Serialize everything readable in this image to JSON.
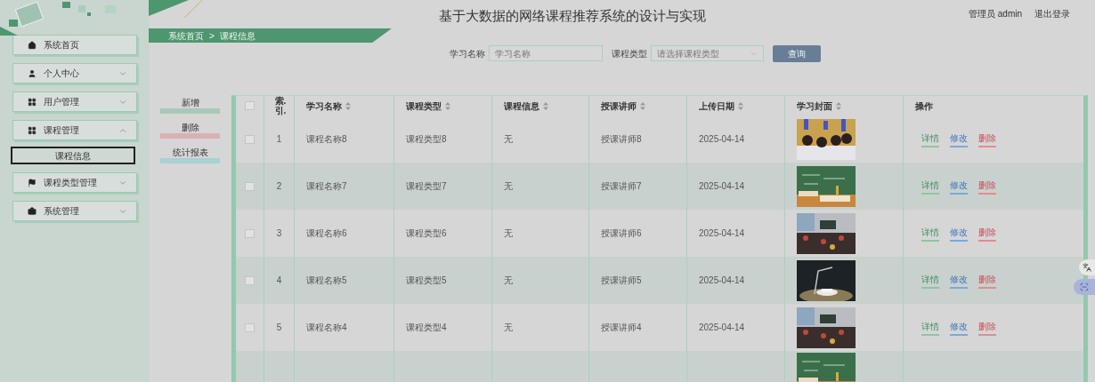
{
  "header": {
    "title": "基于大数据的网络课程推荐系统的设计与实现",
    "user": "管理员 admin",
    "logout": "退出登录"
  },
  "sidebar": {
    "items": [
      {
        "label": "系统首页"
      },
      {
        "label": "个人中心",
        "expanded": false
      },
      {
        "label": "用户管理",
        "expanded": false
      },
      {
        "label": "课程管理",
        "expanded": true,
        "children": [
          {
            "label": "课程信息",
            "selected": true
          }
        ]
      },
      {
        "label": "课程类型管理",
        "expanded": false
      },
      {
        "label": "系统管理",
        "expanded": false
      }
    ]
  },
  "breadcrumb": [
    "系统首页",
    ">",
    "课程信息"
  ],
  "search": {
    "fields": [
      {
        "label": "学习名称",
        "placeholder": "学习名称",
        "kind": "text"
      },
      {
        "label": "课程类型",
        "placeholder": "请选择课程类型",
        "kind": "select"
      }
    ],
    "button": "查询"
  },
  "actions": [
    {
      "label": "新增",
      "color": "#a9c8b8"
    },
    {
      "label": "删除",
      "color": "#dcb0b3"
    },
    {
      "label": "统计报表",
      "color": "#a9d0d2"
    }
  ],
  "table": {
    "select_all": {
      "checked": false
    },
    "columns": [
      "索.引.",
      "学习名称",
      "课程类型",
      "课程信息",
      "授课讲师",
      "上传日期",
      "学习封面",
      "操作"
    ],
    "rows": [
      {
        "checked": false,
        "index": "1",
        "name": "课程名称8",
        "type": "课程类型8",
        "info": "无",
        "teacher": "授课讲师8",
        "date": "2025-04-14",
        "cover": {
          "kind": "picture"
        },
        "ops": [
          "详情",
          "修改",
          "删除"
        ]
      },
      {
        "checked": false,
        "index": "2",
        "name": "课程名称7",
        "type": "课程类型7",
        "info": "无",
        "teacher": "授课讲师7",
        "date": "2025-04-14",
        "cover": {
          "kind": "picture"
        },
        "ops": [
          "详情",
          "修改",
          "删除"
        ]
      },
      {
        "checked": false,
        "index": "3",
        "name": "课程名称6",
        "type": "课程类型6",
        "info": "无",
        "teacher": "授课讲师6",
        "date": "2025-04-14",
        "cover": {
          "kind": "picture"
        },
        "ops": [
          "详情",
          "修改",
          "删除"
        ]
      },
      {
        "checked": false,
        "index": "4",
        "name": "课程名称5",
        "type": "课程类型5",
        "info": "无",
        "teacher": "授课讲师5",
        "date": "2025-04-14",
        "cover": {
          "kind": "picture"
        },
        "ops": [
          "详情",
          "修改",
          "删除"
        ]
      },
      {
        "checked": false,
        "index": "5",
        "name": "课程名称4",
        "type": "课程类型4",
        "info": "无",
        "teacher": "授课讲师4",
        "date": "2025-04-14",
        "cover": {
          "kind": "picture"
        },
        "ops": [
          "详情",
          "修改",
          "删除"
        ]
      },
      {
        "cover": {
          "kind": "picture"
        }
      }
    ]
  }
}
